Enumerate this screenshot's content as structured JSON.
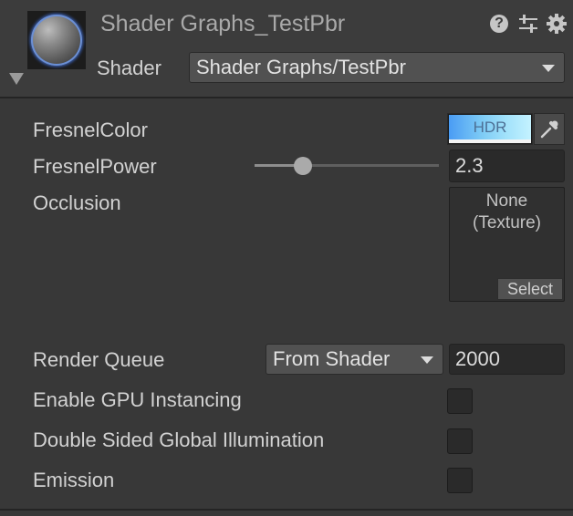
{
  "header": {
    "title": "Shader Graphs_TestPbr",
    "shader_label": "Shader",
    "shader_value": "Shader Graphs/TestPbr",
    "icons": [
      "help-icon",
      "presets-icon",
      "gear-icon"
    ]
  },
  "properties": {
    "fresnel_color": {
      "label": "FresnelColor",
      "badge": "HDR",
      "colors": [
        "#4a9cf4",
        "#c4f2ff"
      ]
    },
    "fresnel_power": {
      "label": "FresnelPower",
      "value": "2.3",
      "slider_fraction": 0.26
    },
    "occlusion": {
      "label": "Occlusion",
      "texture_line1": "None",
      "texture_line2": "(Texture)",
      "select_label": "Select"
    }
  },
  "advanced": {
    "render_queue": {
      "label": "Render Queue",
      "mode": "From Shader",
      "value": "2000"
    },
    "gpu_instancing": {
      "label": "Enable GPU Instancing",
      "checked": false
    },
    "double_sided_gi": {
      "label": "Double Sided Global Illumination",
      "checked": false
    },
    "emission": {
      "label": "Emission",
      "checked": false
    }
  }
}
